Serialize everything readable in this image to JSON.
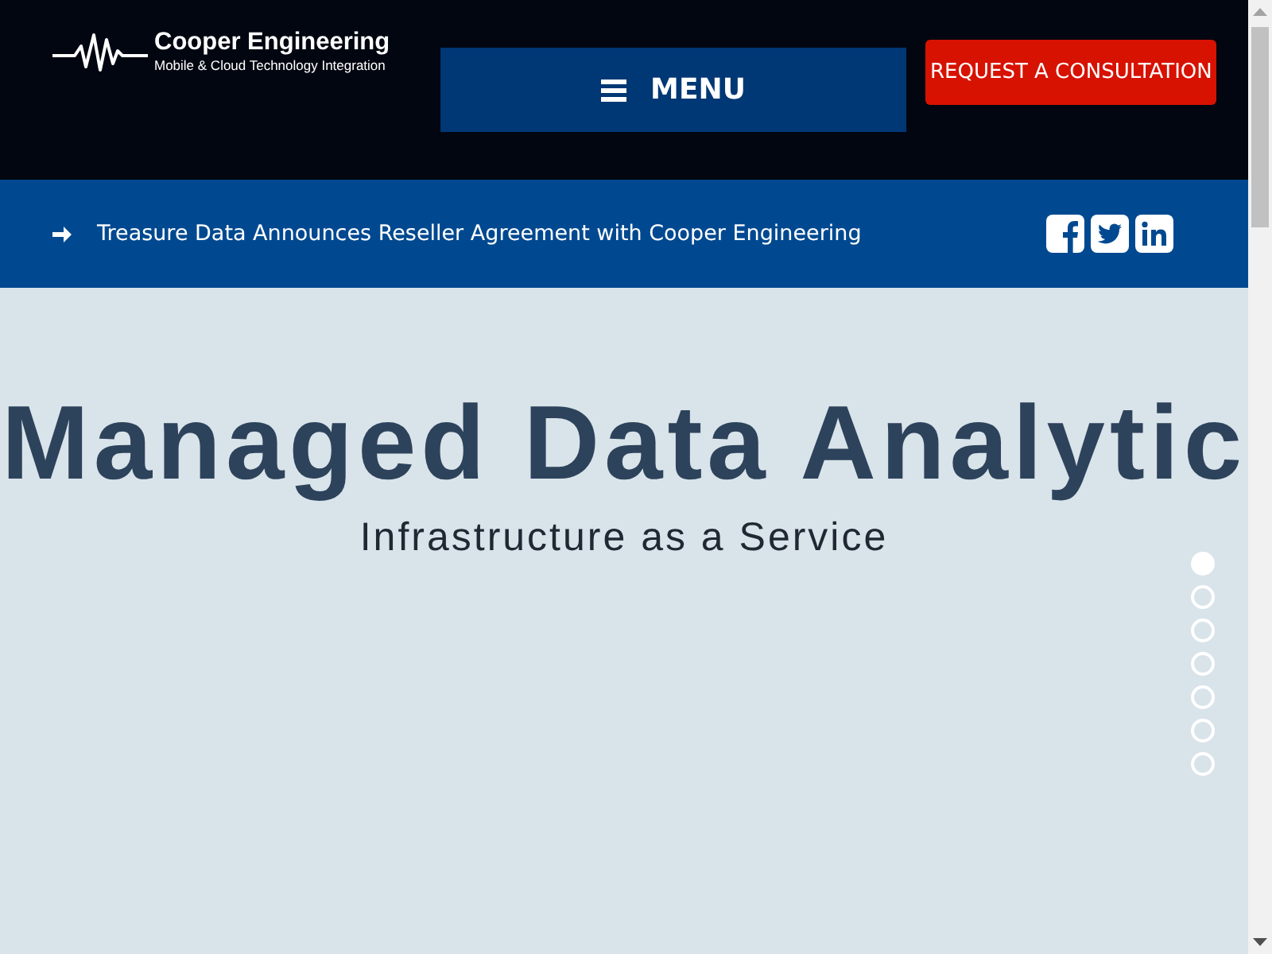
{
  "header": {
    "logo": {
      "name": "Cooper Engineering",
      "tagline": "Mobile & Cloud Technology Integration"
    },
    "menu_button": {
      "label": "MENU"
    },
    "cta_button": {
      "label": "REQUEST A CONSULTATION"
    }
  },
  "news_bar": {
    "headline": "Treasure Data Announces Reseller Agreement with Cooper Engineering"
  },
  "hero": {
    "title": "Managed Data Analytic",
    "subtitle": "Infrastructure as a Service",
    "slides": [
      {
        "selected": true
      },
      {
        "selected": false
      },
      {
        "selected": false
      },
      {
        "selected": false
      },
      {
        "selected": false
      },
      {
        "selected": false
      },
      {
        "selected": false
      }
    ]
  }
}
